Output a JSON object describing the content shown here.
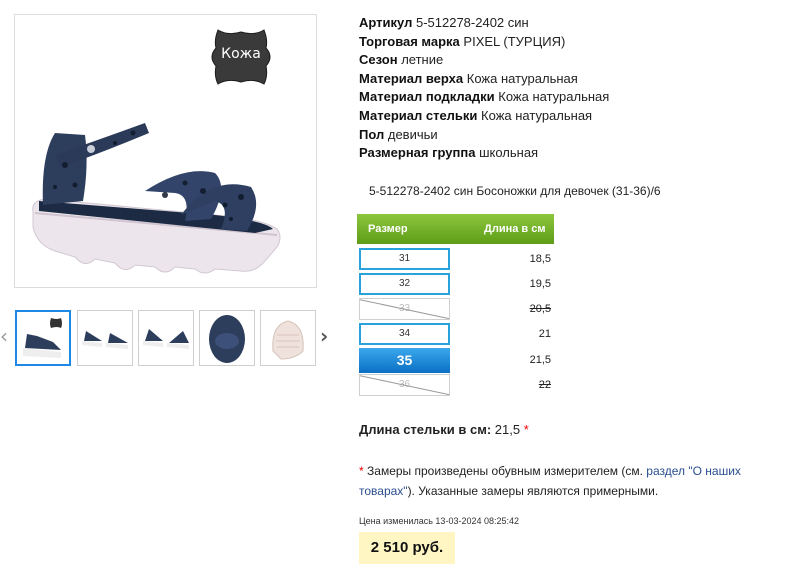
{
  "product": {
    "badge_text": "Кожа",
    "attributes": [
      {
        "label": "Артикул",
        "value": "5-512278-2402 син"
      },
      {
        "label": "Торговая марка",
        "value": "PIXEL (ТУРЦИЯ)"
      },
      {
        "label": "Сезон",
        "value": "летние"
      },
      {
        "label": "Материал верха",
        "value": "Кожа натуральная"
      },
      {
        "label": "Материал подкладки",
        "value": "Кожа натуральная"
      },
      {
        "label": "Материал стельки",
        "value": "Кожа натуральная"
      },
      {
        "label": "Пол",
        "value": "девичьи"
      },
      {
        "label": "Размерная группа",
        "value": "школьная"
      }
    ],
    "name": "5-512278-2402 син Босоножки для девочек (31-36)/6"
  },
  "gallery": {
    "prev_icon": "chevron-left-icon",
    "next_icon": "chevron-right-icon",
    "thumbnails": [
      "thumb-main",
      "thumb-pair",
      "thumb-pair-back",
      "thumb-top",
      "thumb-sole"
    ]
  },
  "size_table": {
    "header_size": "Размер",
    "header_length": "Длина в см",
    "rows": [
      {
        "size": "31",
        "length": "18,5",
        "state": "available"
      },
      {
        "size": "32",
        "length": "19,5",
        "state": "available"
      },
      {
        "size": "33",
        "length": "20,5",
        "state": "disabled"
      },
      {
        "size": "34",
        "length": "21",
        "state": "available"
      },
      {
        "size": "35",
        "length": "21,5",
        "state": "selected"
      },
      {
        "size": "36",
        "length": "22",
        "state": "disabled"
      }
    ]
  },
  "insole": {
    "label": "Длина стельки в см:",
    "value": "21,5",
    "asterisk": "*"
  },
  "note": {
    "asterisk": "*",
    "text_before": "Замеры произведены обувным измерителем (см.",
    "link": "раздел \"О наших товарах\"",
    "text_after": "). Указанные замеры являются примерными."
  },
  "price": {
    "changed": "Цена изменилась 13-03-2024 08:25:42",
    "value": "2 510 руб."
  },
  "colors": {
    "accent_green": "#6fb12a",
    "accent_blue": "#1e88e5",
    "price_bg": "#fff6c4",
    "link": "#2a4d8f"
  }
}
